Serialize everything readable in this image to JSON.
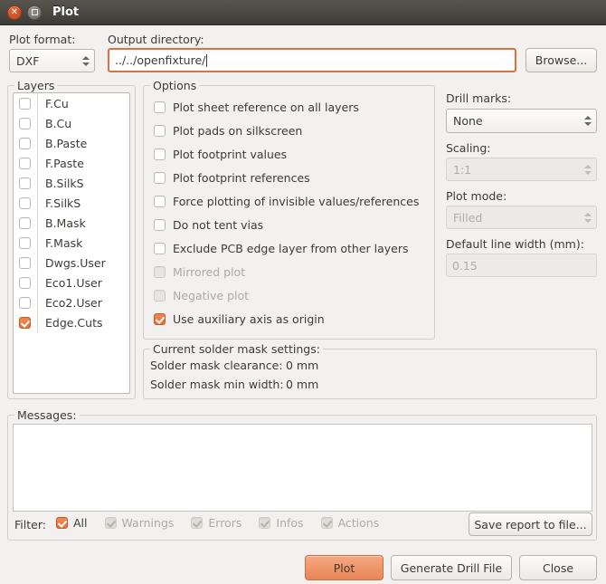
{
  "window": {
    "title": "Plot",
    "close_icon": "close-icon",
    "maximize_icon": "maximize-icon",
    "accent_color": "#e2703a",
    "titlebar_color": "#4b4843"
  },
  "top": {
    "plot_format_label": "Plot format:",
    "plot_format_value": "DXF",
    "output_directory_label": "Output directory:",
    "output_directory_value": "../../openfixture/",
    "browse_label": "Browse..."
  },
  "layers": {
    "title": "Layers",
    "items": [
      {
        "label": "F.Cu",
        "checked": false
      },
      {
        "label": "B.Cu",
        "checked": false
      },
      {
        "label": "B.Paste",
        "checked": false
      },
      {
        "label": "F.Paste",
        "checked": false
      },
      {
        "label": "B.SilkS",
        "checked": false
      },
      {
        "label": "F.SilkS",
        "checked": false
      },
      {
        "label": "B.Mask",
        "checked": false
      },
      {
        "label": "F.Mask",
        "checked": false
      },
      {
        "label": "Dwgs.User",
        "checked": false
      },
      {
        "label": "Eco1.User",
        "checked": false
      },
      {
        "label": "Eco2.User",
        "checked": false
      },
      {
        "label": "Edge.Cuts",
        "checked": true
      }
    ]
  },
  "options": {
    "title": "Options",
    "items": [
      {
        "label": "Plot sheet reference on all layers",
        "checked": false,
        "enabled": true
      },
      {
        "label": "Plot pads on silkscreen",
        "checked": false,
        "enabled": true
      },
      {
        "label": "Plot footprint values",
        "checked": false,
        "enabled": true
      },
      {
        "label": "Plot footprint references",
        "checked": false,
        "enabled": true
      },
      {
        "label": "Force plotting of invisible values/references",
        "checked": false,
        "enabled": true
      },
      {
        "label": "Do not tent vias",
        "checked": false,
        "enabled": true
      },
      {
        "label": "Exclude PCB edge layer from other layers",
        "checked": false,
        "enabled": true
      },
      {
        "label": "Mirrored plot",
        "checked": false,
        "enabled": false
      },
      {
        "label": "Negative plot",
        "checked": false,
        "enabled": false
      },
      {
        "label": "Use auxiliary axis as origin",
        "checked": true,
        "enabled": true
      }
    ]
  },
  "right": {
    "drill_marks_label": "Drill marks:",
    "drill_marks_value": "None",
    "scaling_label": "Scaling:",
    "scaling_value": "1:1",
    "plot_mode_label": "Plot mode:",
    "plot_mode_value": "Filled",
    "line_width_label": "Default line width (mm):",
    "line_width_value": "0.15"
  },
  "soldermask": {
    "title": "Current solder mask settings:",
    "clearance_label": "Solder mask clearance:",
    "clearance_value": "0 mm",
    "minwidth_label": "Solder mask min width:",
    "minwidth_value": "0 mm"
  },
  "messages": {
    "title": "Messages:",
    "body": ""
  },
  "filter": {
    "label": "Filter:",
    "items": [
      {
        "label": "All",
        "checked": true,
        "enabled": true
      },
      {
        "label": "Warnings",
        "checked": true,
        "enabled": false
      },
      {
        "label": "Errors",
        "checked": true,
        "enabled": false
      },
      {
        "label": "Infos",
        "checked": true,
        "enabled": false
      },
      {
        "label": "Actions",
        "checked": true,
        "enabled": false
      }
    ],
    "save_report_label": "Save report to file..."
  },
  "actions": {
    "plot_label": "Plot",
    "generate_drill_label": "Generate Drill File",
    "close_label": "Close"
  }
}
